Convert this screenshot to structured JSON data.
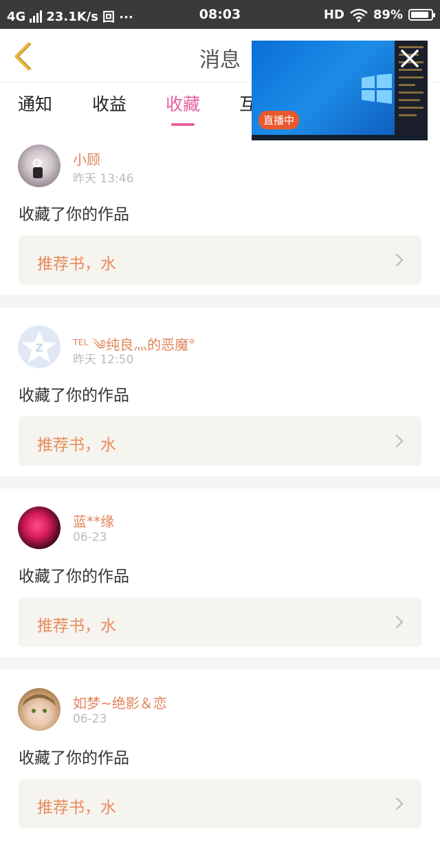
{
  "status_bar": {
    "network": "4G",
    "speed": "23.1K/s",
    "extra": "回 ···",
    "time": "08:03",
    "hd": "HD",
    "battery": "89%",
    "battery_level": 0.89
  },
  "header": {
    "title": "消息",
    "back_icon": "chevron-left-icon"
  },
  "tabs": [
    {
      "label": "通知",
      "active": false
    },
    {
      "label": "收益",
      "active": false
    },
    {
      "label": "收藏",
      "active": true
    },
    {
      "label": "互",
      "active": false
    }
  ],
  "live_overlay": {
    "badge": "直播中",
    "close_icon": "close-icon"
  },
  "messages": [
    {
      "user": "小顾",
      "time": "昨天 13:46",
      "action": "收藏了你的作品",
      "ref": "推荐书，水"
    },
    {
      "user": "ᵀᴱᴸ ༄纯良灬的恶魔°",
      "time": "昨天 12:50",
      "action": "收藏了你的作品",
      "ref": "推荐书，水"
    },
    {
      "user": "蓝**缘",
      "time": "06-23",
      "action": "收藏了你的作品",
      "ref": "推荐书，水"
    },
    {
      "user": "如梦~绝影＆恋",
      "time": "06-23",
      "action": "收藏了你的作品",
      "ref": "推荐书，水"
    }
  ]
}
